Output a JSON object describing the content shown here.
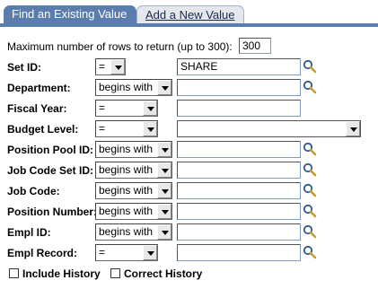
{
  "tabs": [
    {
      "label": "Find an Existing Value",
      "active": true
    },
    {
      "label": "Add a New Value",
      "active": false
    }
  ],
  "max_rows": {
    "label": "Maximum number of rows to return (up to 300):",
    "value": "300"
  },
  "fields": [
    {
      "label": "Set ID:",
      "operator": "=",
      "value": "SHARE",
      "lookup": true
    },
    {
      "label": "Department:",
      "operator": "begins with",
      "value": "",
      "lookup": true
    },
    {
      "label": "Fiscal Year:",
      "operator": "=",
      "value": "",
      "lookup": false
    },
    {
      "label": "Budget Level:",
      "operator": "=",
      "value": "",
      "lookup": false
    },
    {
      "label": "Position Pool ID:",
      "operator": "begins with",
      "value": "",
      "lookup": true
    },
    {
      "label": "Job Code Set ID:",
      "operator": "begins with",
      "value": "",
      "lookup": true
    },
    {
      "label": "Job Code:",
      "operator": "begins with",
      "value": "",
      "lookup": true
    },
    {
      "label": "Position Number:",
      "operator": "begins with",
      "value": "",
      "lookup": true
    },
    {
      "label": "Empl ID:",
      "operator": "begins with",
      "value": "",
      "lookup": true
    },
    {
      "label": "Empl Record:",
      "operator": "=",
      "value": "",
      "lookup": true
    }
  ],
  "checkboxes": [
    {
      "label": "Include History",
      "checked": false
    },
    {
      "label": "Correct History",
      "checked": false
    }
  ],
  "colors": {
    "tab_active": "#5a7dad",
    "tab_inactive": "#e4e8ed"
  },
  "icons": {
    "lookup": "magnifier-icon",
    "dropdown": "chevron-down-icon"
  }
}
